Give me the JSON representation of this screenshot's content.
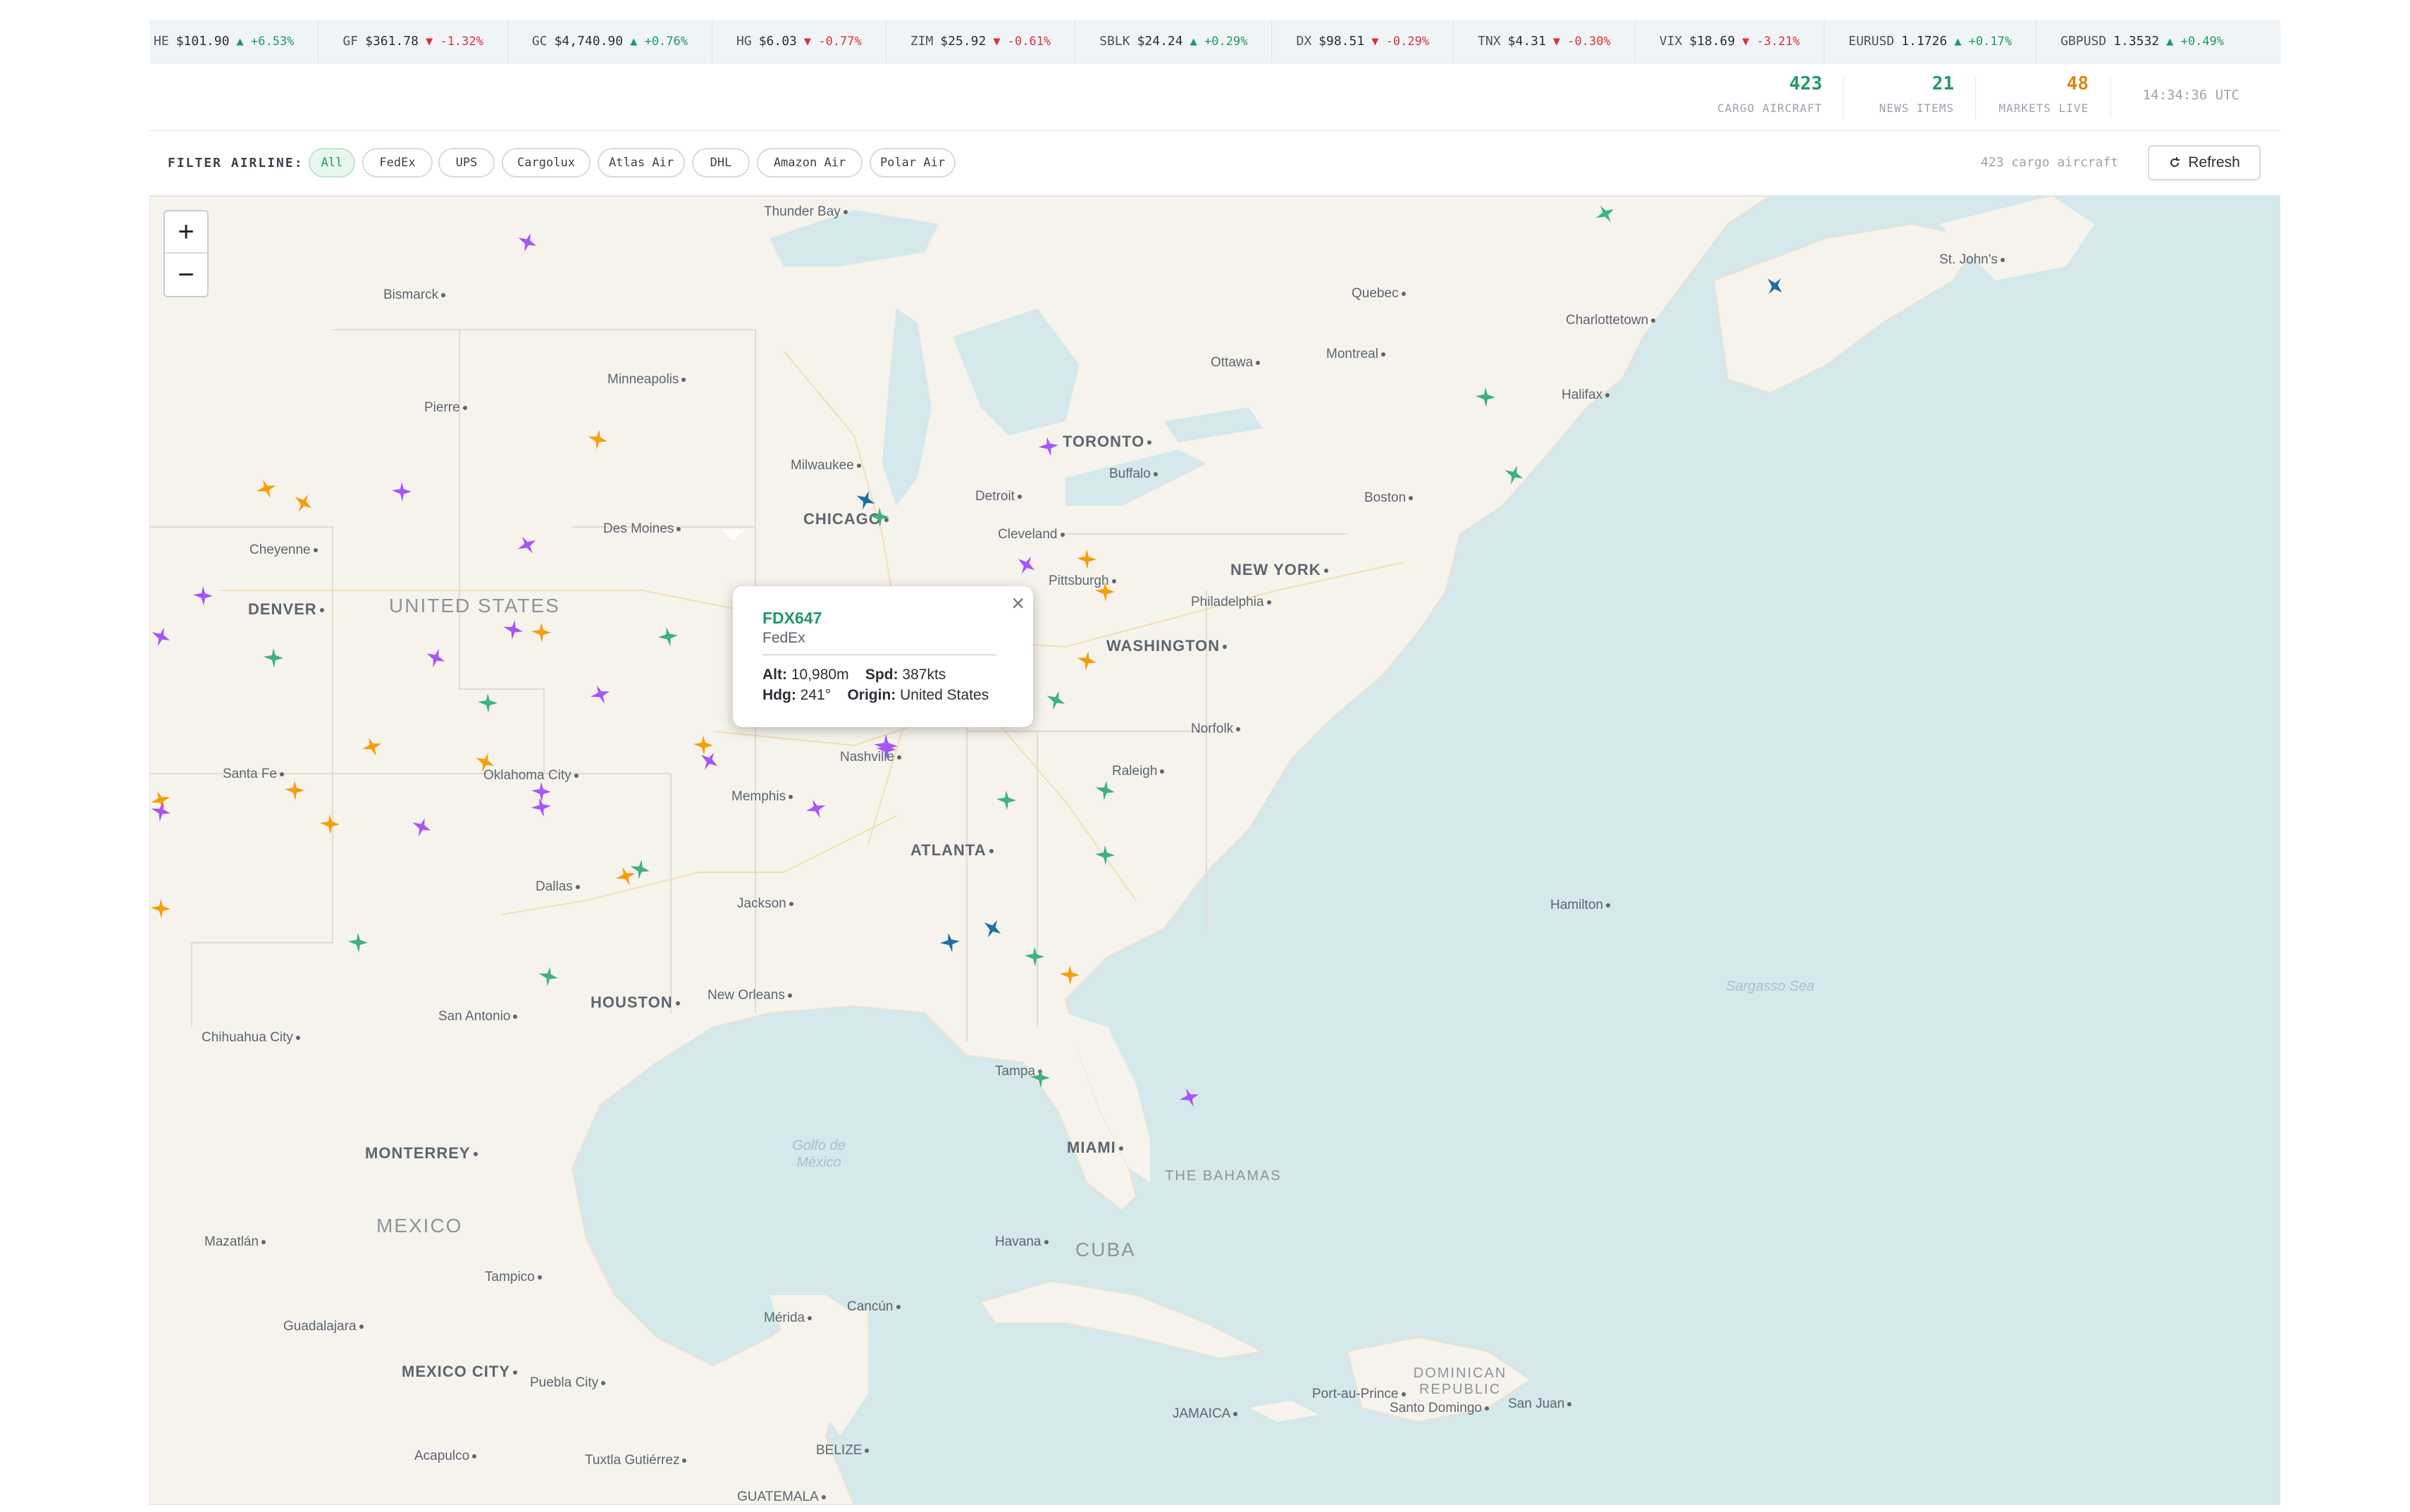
{
  "ticker": [
    {
      "symbol": "HE",
      "price": "$101.90",
      "dir": "up",
      "change": "▲ +6.53%"
    },
    {
      "symbol": "GF",
      "price": "$361.78",
      "dir": "down",
      "change": "▼ -1.32%"
    },
    {
      "symbol": "GC",
      "price": "$4,740.90",
      "dir": "up",
      "change": "▲ +0.76%"
    },
    {
      "symbol": "HG",
      "price": "$6.03",
      "dir": "down",
      "change": "▼ -0.77%"
    },
    {
      "symbol": "ZIM",
      "price": "$25.92",
      "dir": "down",
      "change": "▼ -0.61%"
    },
    {
      "symbol": "SBLK",
      "price": "$24.24",
      "dir": "up",
      "change": "▲ +0.29%"
    },
    {
      "symbol": "DX",
      "price": "$98.51",
      "dir": "down",
      "change": "▼ -0.29%"
    },
    {
      "symbol": "TNX",
      "price": "$4.31",
      "dir": "down",
      "change": "▼ -0.30%"
    },
    {
      "symbol": "VIX",
      "price": "$18.69",
      "dir": "down",
      "change": "▼ -3.21%"
    },
    {
      "symbol": "EURUSD",
      "price": "1.1726",
      "dir": "up",
      "change": "▲ +0.17%"
    },
    {
      "symbol": "GBPUSD",
      "price": "1.3532",
      "dir": "up",
      "change": "▲ +0.49%"
    }
  ],
  "stats": {
    "cargo_aircraft": {
      "value": "423",
      "label": "CARGO AIRCRAFT",
      "color": "#1e9a63"
    },
    "news_items": {
      "value": "21",
      "label": "NEWS ITEMS",
      "color": "#1e9a63"
    },
    "markets_live": {
      "value": "48",
      "label": "MARKETS LIVE",
      "color": "#d68a12"
    },
    "clock": "14:34:36 UTC"
  },
  "filter": {
    "label": "FILTER AIRLINE:",
    "chips": [
      "All",
      "FedEx",
      "UPS",
      "Cargolux",
      "Atlas Air",
      "DHL",
      "Amazon Air",
      "Polar Air"
    ],
    "active": "All",
    "count_text": "423 cargo aircraft",
    "refresh_label": "Refresh"
  },
  "map": {
    "zoom_in": "+",
    "zoom_out": "−",
    "cities": [
      {
        "name": "Thunder Bay",
        "big": false
      },
      {
        "name": "Bismarck",
        "big": false
      },
      {
        "name": "Minneapolis",
        "big": false
      },
      {
        "name": "Pierre",
        "big": false
      },
      {
        "name": "Milwaukee",
        "big": false
      },
      {
        "name": "CHICAGO",
        "big": true
      },
      {
        "name": "Des Moines",
        "big": false
      },
      {
        "name": "Cheyenne",
        "big": false
      },
      {
        "name": "DENVER",
        "big": true
      },
      {
        "name": "Detroit",
        "big": false
      },
      {
        "name": "TORONTO",
        "big": true
      },
      {
        "name": "Buffalo",
        "big": false
      },
      {
        "name": "Cleveland",
        "big": false
      },
      {
        "name": "Pittsburgh",
        "big": false
      },
      {
        "name": "Ottawa",
        "big": false
      },
      {
        "name": "Montreal",
        "big": false
      },
      {
        "name": "Quebec",
        "big": false
      },
      {
        "name": "Boston",
        "big": false
      },
      {
        "name": "NEW YORK",
        "big": true
      },
      {
        "name": "Philadelphia",
        "big": false
      },
      {
        "name": "WASHINGTON",
        "big": true
      },
      {
        "name": "Norfolk",
        "big": false
      },
      {
        "name": "Raleigh",
        "big": false
      },
      {
        "name": "Nashville",
        "big": false
      },
      {
        "name": "Memphis",
        "big": false
      },
      {
        "name": "ATLANTA",
        "big": true
      },
      {
        "name": "Jackson",
        "big": false
      },
      {
        "name": "New Orleans",
        "big": false
      },
      {
        "name": "Santa Fe",
        "big": false
      },
      {
        "name": "Oklahoma City",
        "big": false
      },
      {
        "name": "Dallas",
        "big": false
      },
      {
        "name": "HOUSTON",
        "big": true
      },
      {
        "name": "San Antonio",
        "big": false
      },
      {
        "name": "Chihuahua City",
        "big": false
      },
      {
        "name": "MONTERREY",
        "big": true
      },
      {
        "name": "Tampa",
        "big": false
      },
      {
        "name": "MIAMI",
        "big": true
      },
      {
        "name": "Havana",
        "big": false
      },
      {
        "name": "Mazatlán",
        "big": false
      },
      {
        "name": "Tampico",
        "big": false
      },
      {
        "name": "Guadalajara",
        "big": false
      },
      {
        "name": "MEXICO CITY",
        "big": true
      },
      {
        "name": "Puebla City",
        "big": false
      },
      {
        "name": "Mérida",
        "big": false
      },
      {
        "name": "Cancún",
        "big": false
      },
      {
        "name": "Acapulco",
        "big": false
      },
      {
        "name": "Tuxtla Gutiérrez",
        "big": false
      },
      {
        "name": "BELIZE",
        "big": false
      },
      {
        "name": "GUATEMALA",
        "big": false
      },
      {
        "name": "JAMAICA",
        "big": false
      },
      {
        "name": "Port-au-Prince",
        "big": false
      },
      {
        "name": "Santo Domingo",
        "big": false
      },
      {
        "name": "San Juan",
        "big": false
      },
      {
        "name": "Hamilton",
        "big": false
      },
      {
        "name": "Halifax",
        "big": false
      },
      {
        "name": "Charlottetown",
        "big": false
      },
      {
        "name": "St. John's",
        "big": false
      }
    ],
    "countries": [
      "UNITED STATES",
      "MEXICO",
      "CUBA",
      "THE BAHAMAS",
      "DOMINICAN REPUBLIC"
    ],
    "waters": [
      "Golfo de México",
      "Sargasso Sea"
    ],
    "airline_colors": {
      "purple": "#a855f7",
      "orange": "#f59e0b",
      "green": "#3fb27f",
      "blue": "#1d6fa5"
    }
  },
  "popup": {
    "callsign": "FDX647",
    "airline": "FedEx",
    "alt_label": "Alt:",
    "alt": "10,980m",
    "spd_label": "Spd:",
    "spd": "387kts",
    "hdg_label": "Hdg:",
    "hdg": "241°",
    "origin_label": "Origin:",
    "origin": "United States",
    "close": "×"
  }
}
